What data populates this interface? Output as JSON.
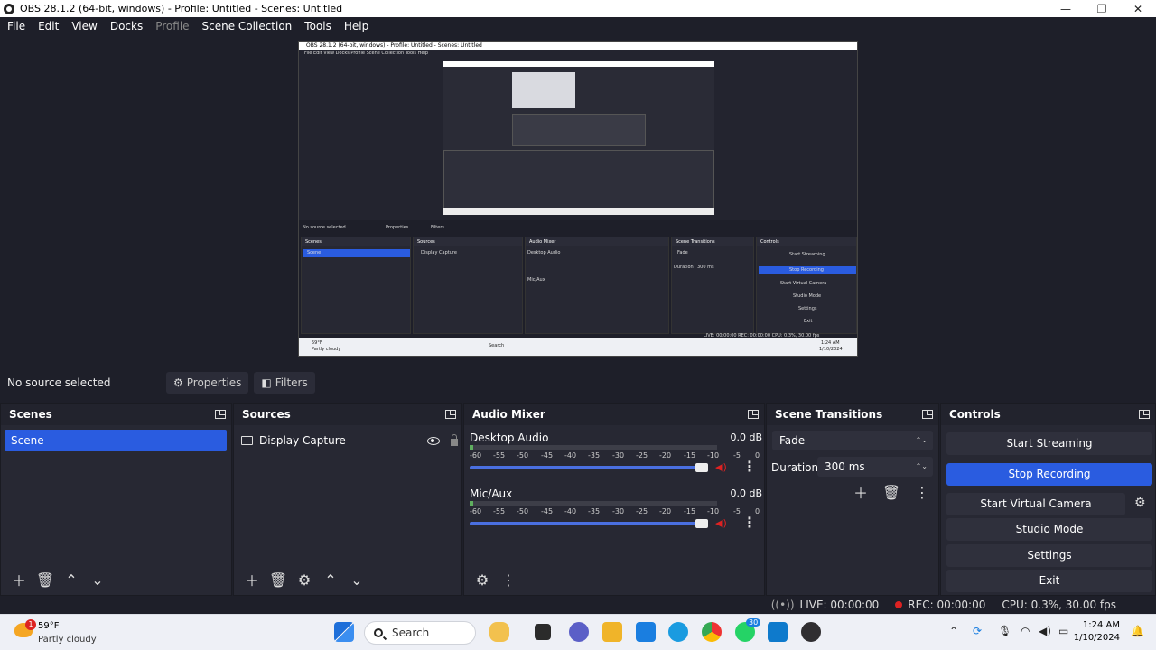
{
  "window": {
    "title": "OBS 28.1.2 (64-bit, windows) - Profile: Untitled - Scenes: Untitled",
    "minimize": "—",
    "maximize": "❐",
    "close": "✕"
  },
  "menu": [
    "File",
    "Edit",
    "View",
    "Docks",
    "Profile",
    "Scene Collection",
    "Tools",
    "Help"
  ],
  "preview": {
    "mini_title": "OBS 28.1.2 (64-bit, windows) - Profile: Untitled - Scenes: Untitled",
    "mini_menu": "File  Edit  View  Docks  Profile  Scene Collection  Tools  Help",
    "mini_nosel": "No source selected",
    "mini_props": "Properties",
    "mini_filters": "Filters",
    "mini_docks": [
      "Scenes",
      "Sources",
      "Audio Mixer",
      "Scene Transitions",
      "Controls"
    ],
    "mini_scene": "Scene",
    "mini_source": "Display Capture",
    "mini_desktop": "Desktop Audio",
    "mini_mic": "Mic/Aux",
    "mini_fade": "Fade",
    "mini_duration": "Duration",
    "mini_duration_val": "300 ms",
    "mini_controls": [
      "Start Streaming",
      "Stop Recording",
      "Start Virtual Camera",
      "Studio Mode",
      "Settings",
      "Exit"
    ],
    "mini_status": "LIVE: 00:00:00   REC: 00:00:00   CPU: 0.3%, 30.00 fps",
    "mini_weather": "59°F",
    "mini_weather_cond": "Partly cloudy",
    "mini_search": "Search",
    "mini_clock": "1:24 AM",
    "mini_date": "1/10/2024"
  },
  "source_toolbar": {
    "no_source": "No source selected",
    "properties": "Properties",
    "filters": "Filters"
  },
  "scenes": {
    "title": "Scenes",
    "items": [
      "Scene"
    ]
  },
  "sources": {
    "title": "Sources",
    "items": [
      "Display Capture"
    ]
  },
  "mixer": {
    "title": "Audio Mixer",
    "channels": [
      {
        "name": "Desktop Audio",
        "db": "0.0 dB"
      },
      {
        "name": "Mic/Aux",
        "db": "0.0 dB"
      }
    ],
    "scale": [
      "-60",
      "-55",
      "-50",
      "-45",
      "-40",
      "-35",
      "-30",
      "-25",
      "-20",
      "-15",
      "-10",
      "-5",
      "0"
    ]
  },
  "transitions": {
    "title": "Scene Transitions",
    "type": "Fade",
    "duration_label": "Duration",
    "duration_value": "300 ms"
  },
  "controls": {
    "title": "Controls",
    "buttons": [
      "Start Streaming",
      "Stop Recording",
      "Start Virtual Camera",
      "Studio Mode",
      "Settings",
      "Exit"
    ]
  },
  "status": {
    "live": "LIVE: 00:00:00",
    "rec": "REC: 00:00:00",
    "cpu": "CPU: 0.3%, 30.00 fps"
  },
  "taskbar": {
    "weather_badge": "1",
    "temp": "59°F",
    "condition": "Partly cloudy",
    "search": "Search",
    "whatsapp_badge": "30",
    "time": "1:24 AM",
    "date": "1/10/2024"
  },
  "colors": {
    "accent": "#2a5ce0",
    "background": "#1e1f29",
    "panel": "#272833",
    "record": "#dd2222"
  }
}
